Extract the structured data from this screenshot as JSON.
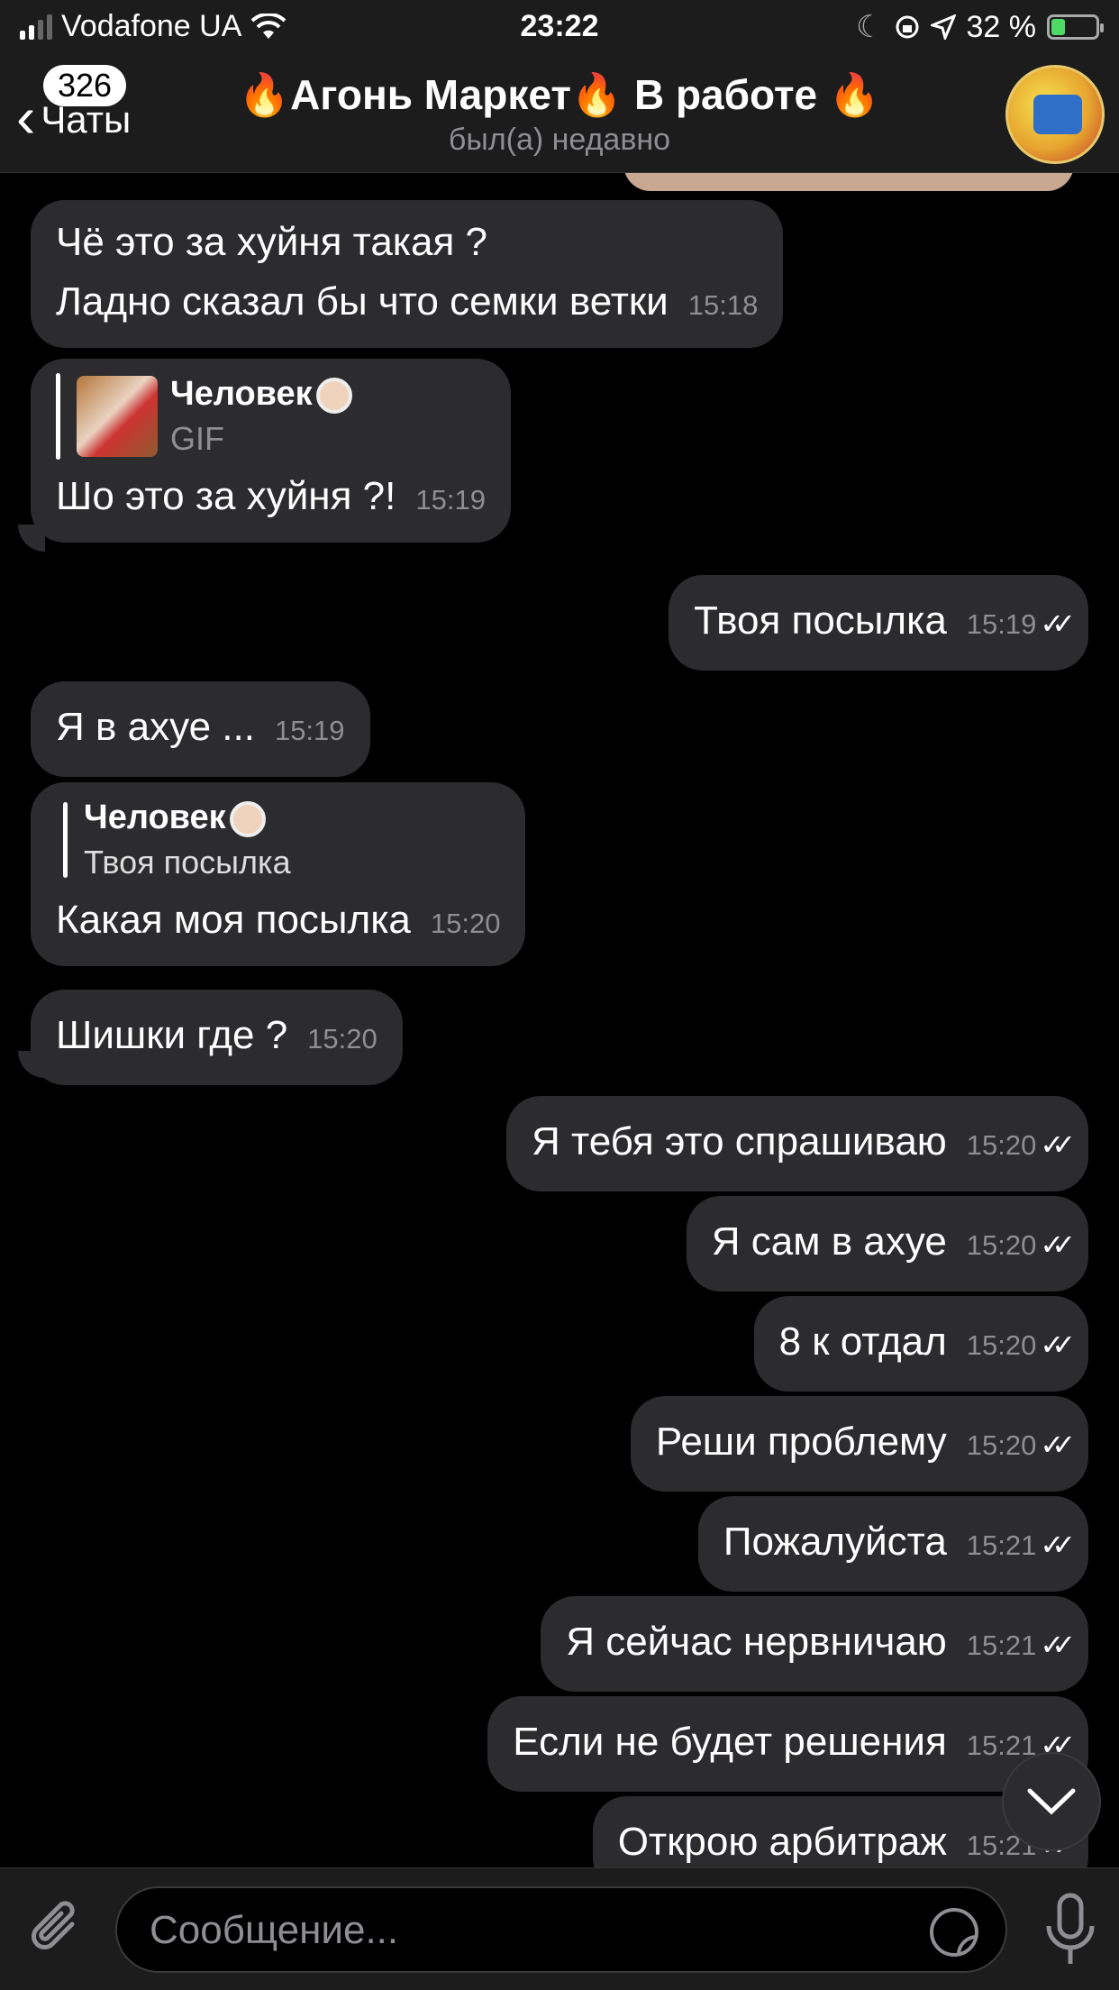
{
  "status": {
    "carrier": "Vodafone UA",
    "time": "23:22",
    "battery": "32 %",
    "battery_level": 0.32
  },
  "header": {
    "back_label": "Чаты",
    "unread_badge": "326",
    "title": "🔥Агонь Маркет🔥 В работе 🔥",
    "subtitle": "был(а) недавно"
  },
  "messages": [
    {
      "dir": "in",
      "lines": [
        "Чё это за хуйня такая ?",
        "Ладно сказал бы что семки ветки"
      ],
      "time": "15:18"
    },
    {
      "dir": "in",
      "reply_name": "Человек",
      "reply_text": "GIF",
      "text": "Шо это за хуйня ?!",
      "time": "15:19"
    },
    {
      "dir": "out",
      "text": "Твоя посылка",
      "time": "15:19"
    },
    {
      "dir": "in",
      "text": "Я в ахуе ...",
      "time": "15:19"
    },
    {
      "dir": "in",
      "reply_name": "Человек",
      "reply_text": "Твоя посылка",
      "text": "Какая моя посылка",
      "time": "15:20"
    },
    {
      "dir": "in",
      "text": "Шишки где ?",
      "time": "15:20"
    },
    {
      "dir": "out",
      "text": "Я тебя это спрашиваю",
      "time": "15:20"
    },
    {
      "dir": "out",
      "text": "Я сам в ахуе",
      "time": "15:20"
    },
    {
      "dir": "out",
      "text": "8 к отдал",
      "time": "15:20"
    },
    {
      "dir": "out",
      "text": "Реши проблему",
      "time": "15:20"
    },
    {
      "dir": "out",
      "text": "Пожалуйста",
      "time": "15:21"
    },
    {
      "dir": "out",
      "text": "Я сейчас нервничаю",
      "time": "15:21"
    },
    {
      "dir": "out",
      "text": "Если не будет решения",
      "time": "15:21"
    },
    {
      "dir": "out",
      "text": "Открою арбитраж",
      "time": "15:21"
    }
  ],
  "input": {
    "placeholder": "Сообщение..."
  },
  "icons": {
    "back": "chevron-left-icon",
    "attach": "paperclip-icon",
    "sticker": "sticker-icon",
    "mic": "microphone-icon",
    "scroll": "chevron-down-icon",
    "read": "double-check-icon"
  }
}
